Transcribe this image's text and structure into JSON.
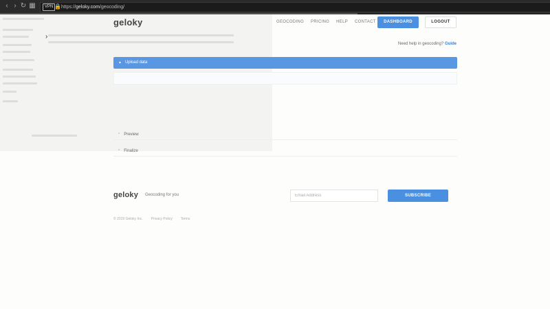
{
  "browser": {
    "vpn_label": "VPN",
    "url_scheme": "https://",
    "url_host": "geloky.com",
    "url_path": "/geocoding/"
  },
  "header": {
    "logo": "geloky",
    "nav": [
      "GEOCODING",
      "PRICING",
      "HELP",
      "CONTACT"
    ],
    "dashboard_label": "DASHBOARD",
    "logout_label": "LOGOUT"
  },
  "help": {
    "text": "Need help in geocoding? ",
    "link": "Guide"
  },
  "accordion": {
    "upload_label": "Upload data",
    "preview_label": "Preview",
    "finalize_label": "Finalize"
  },
  "footer": {
    "logo": "geloky",
    "tagline": "Geocoding for you",
    "email_placeholder": "Email Address",
    "subscribe_label": "SUBSCRIBE",
    "links": [
      "© 2019 Geloky Inc.",
      "Privacy Policy",
      "Terms"
    ]
  },
  "colors": {
    "accent": "#4a8fe0",
    "section_header": "#5a97e2"
  }
}
